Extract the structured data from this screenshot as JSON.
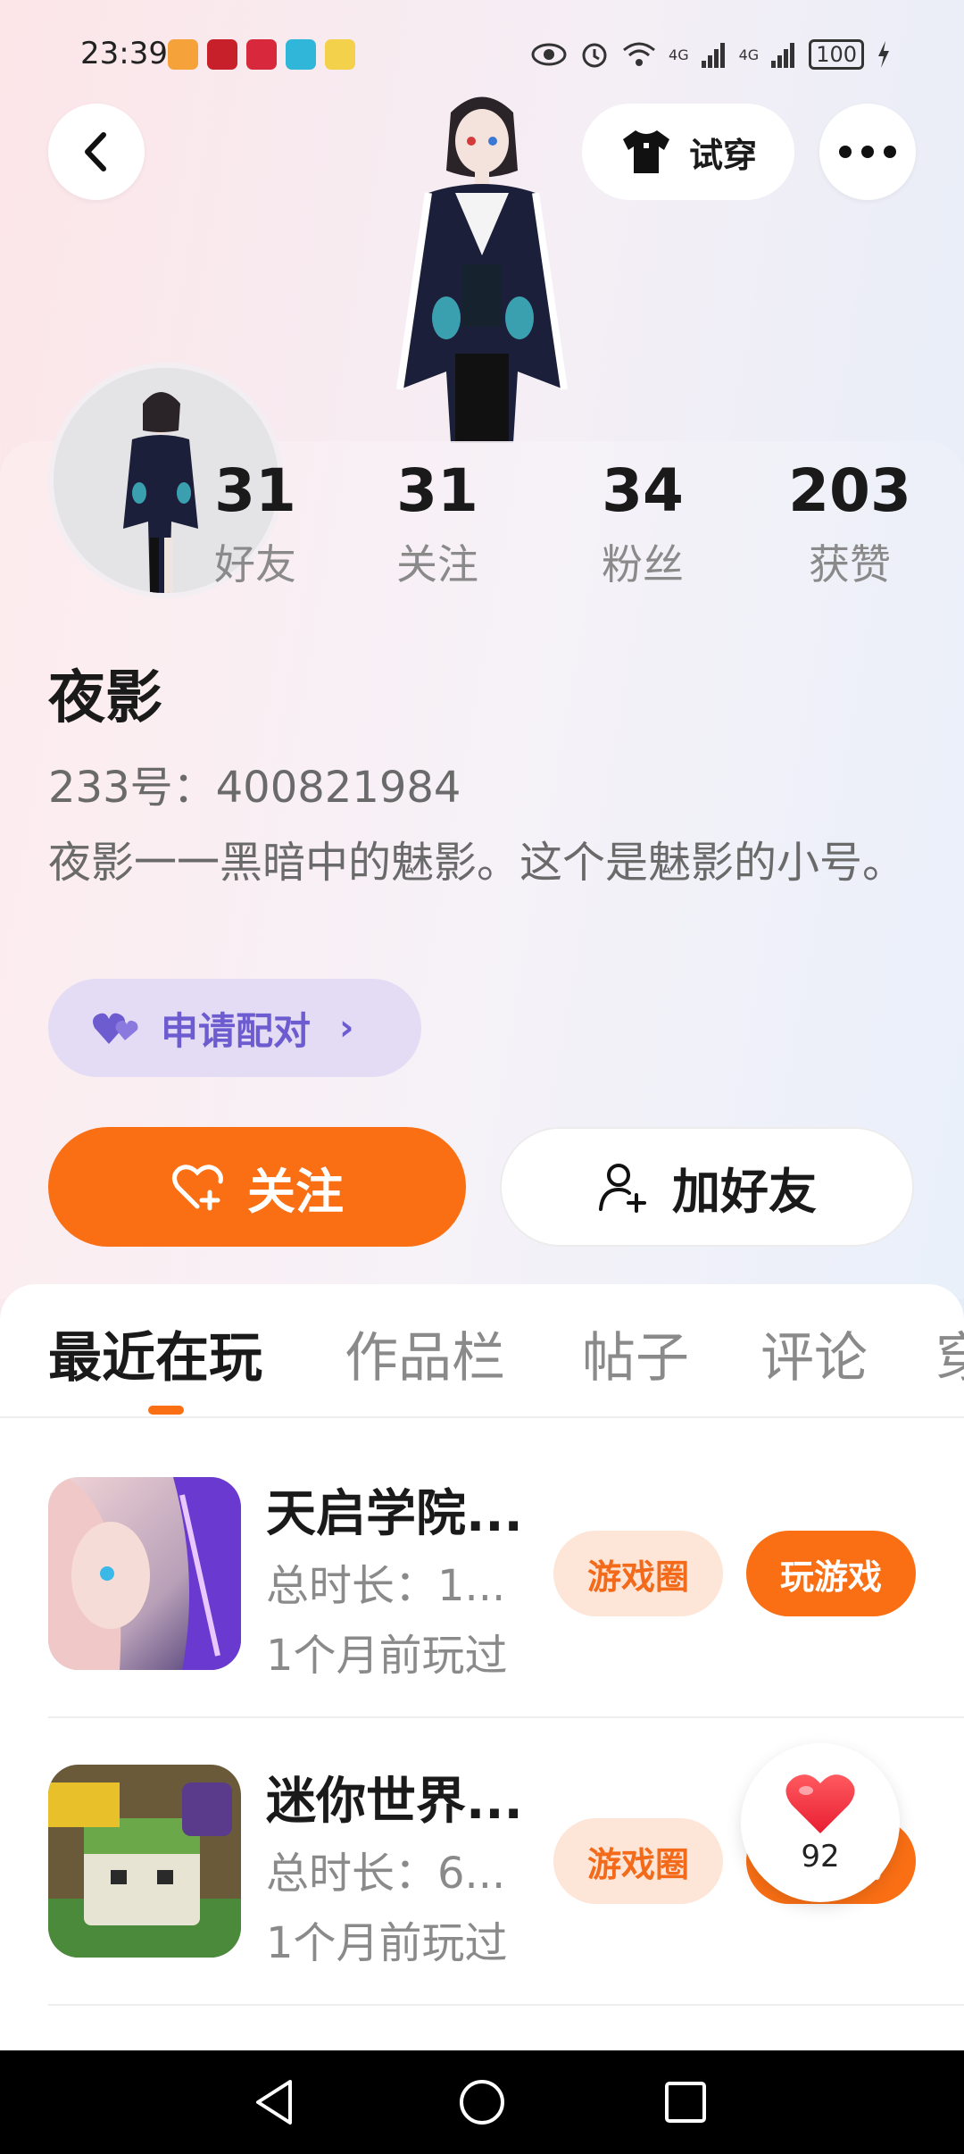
{
  "status_bar": {
    "time": "23:39",
    "network_1": "4G",
    "network_2": "4G",
    "battery": "100"
  },
  "header": {
    "tryon_label": "试穿"
  },
  "profile": {
    "stats": [
      {
        "value": "31",
        "label": "好友"
      },
      {
        "value": "31",
        "label": "关注"
      },
      {
        "value": "34",
        "label": "粉丝"
      },
      {
        "value": "203",
        "label": "获赞"
      }
    ],
    "nickname": "夜影",
    "id_text": "233号：400821984",
    "bio": "夜影一一黑暗中的魅影。这个是魅影的小号。",
    "match_label": "申请配对",
    "follow_label": "关注",
    "add_friend_label": "加好友"
  },
  "tabs": [
    "最近在玩",
    "作品栏",
    "帖子",
    "评论",
    "穿"
  ],
  "games": [
    {
      "title": "天启学院...",
      "duration": "总时长：1...",
      "last_played": "1个月前玩过",
      "circle_label": "游戏圈",
      "play_label": "玩游戏"
    },
    {
      "title": "迷你世界...",
      "duration": "总时长：6...",
      "last_played": "1个月前玩过",
      "circle_label": "游戏圈",
      "play_label": "玩游戏"
    }
  ],
  "float_like": {
    "count": "92"
  },
  "colors": {
    "accent": "#fa6f14",
    "match_purple": "#6d5bd0",
    "heart_red": "#f0303a"
  },
  "icons": {
    "back": "chevron-left-icon",
    "tryon": "tshirt-icon",
    "more": "more-dots-icon",
    "match": "hearts-icon",
    "follow": "heart-plus-icon",
    "add_friend": "user-plus-icon"
  }
}
